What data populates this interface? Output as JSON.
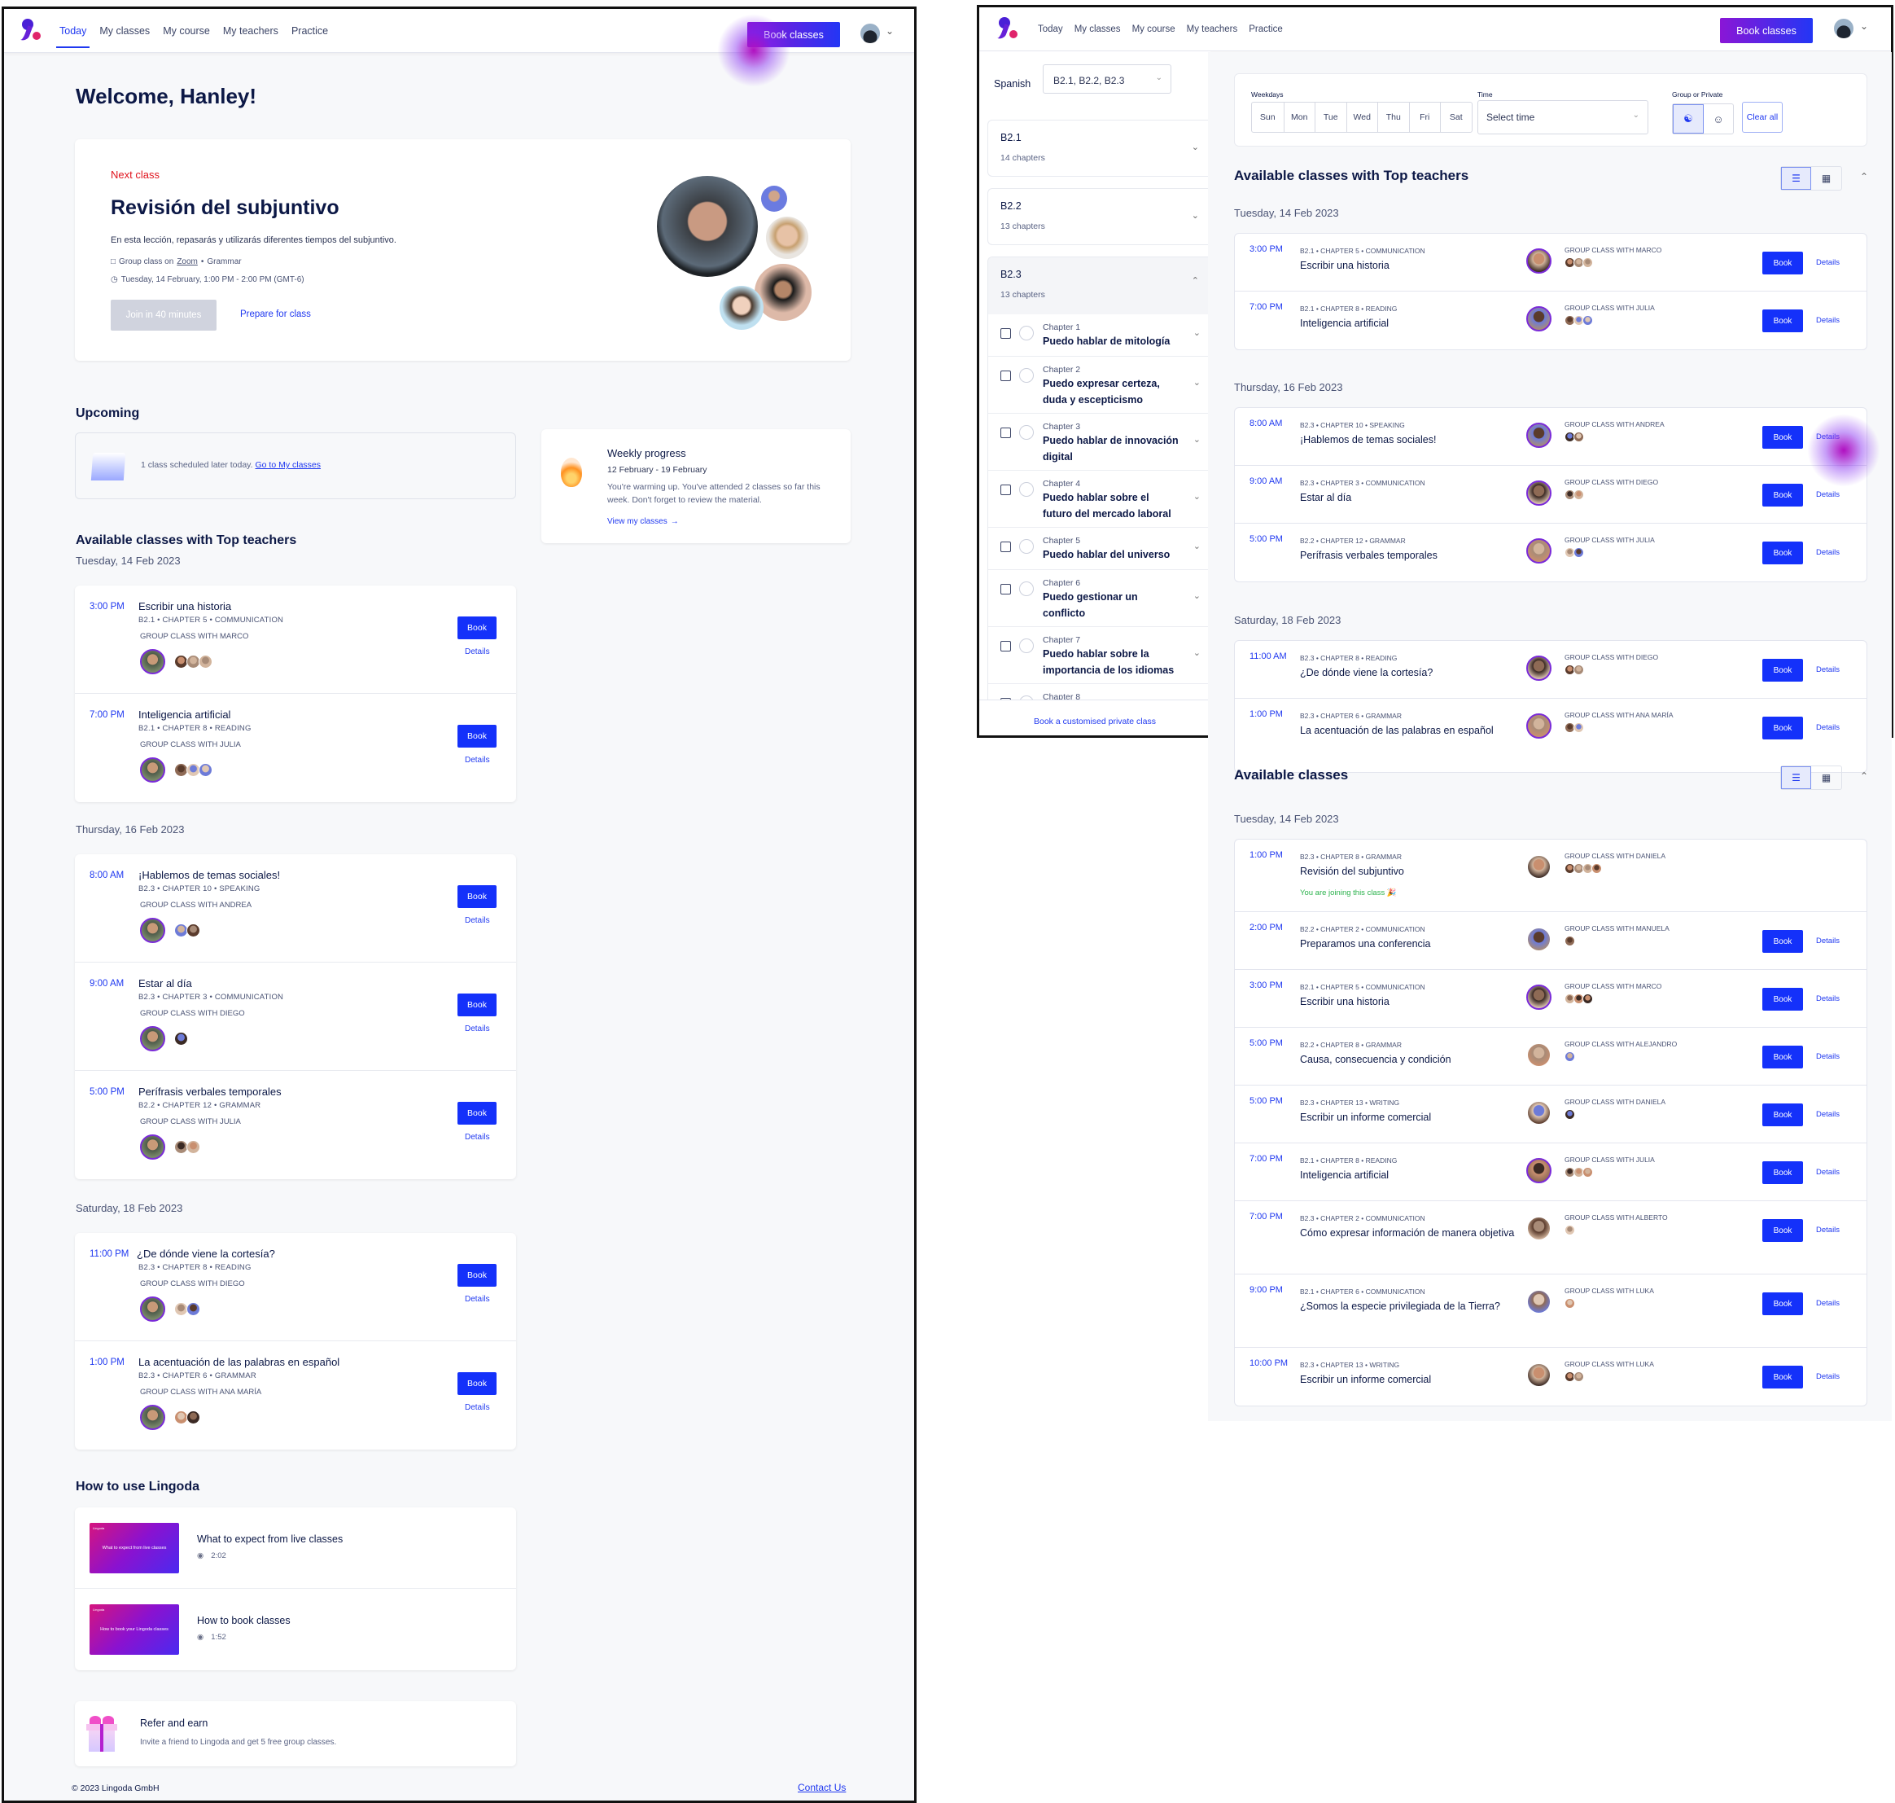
{
  "nav": {
    "links": [
      "Today",
      "My classes",
      "My course",
      "My teachers",
      "Practice"
    ],
    "active": "Today",
    "book_classes": "Book classes"
  },
  "today": {
    "welcome": "Welcome, Hanley!",
    "next_class": {
      "label": "Next class",
      "title": "Revisión del subjuntivo",
      "description": "En esta lección, repasarás y utilizarás diferentes tiempos del subjuntivo.",
      "format": "Group class on",
      "platform": "Zoom",
      "topic": "Grammar",
      "datetime": "Tuesday, 14 February, 1:00 PM - 2:00 PM (GMT-6)",
      "join_button": "Join in 40 minutes",
      "prepare_link": "Prepare for class"
    },
    "upcoming": {
      "heading": "Upcoming",
      "text": "1 class scheduled later today.",
      "link": "Go to My classes"
    },
    "weekly_progress": {
      "title": "Weekly progress",
      "range": "12 February - 19 February",
      "text": "You're warming up. You've attended 2 classes so far this week. Don't forget to review the material.",
      "link": "View my classes"
    },
    "top_heading": "Available classes with Top teachers",
    "groups": [
      {
        "date": "Tuesday, 14 Feb 2023",
        "classes": [
          {
            "time": "3:00 PM",
            "title": "Escribir una historia",
            "meta": "B2.1 • CHAPTER 5 • COMMUNICATION",
            "teacher": "GROUP CLASS WITH MARCO",
            "students": 3
          },
          {
            "time": "7:00 PM",
            "title": "Inteligencia artificial",
            "meta": "B2.1 • CHAPTER 8 • READING",
            "teacher": "GROUP CLASS WITH JULIA",
            "students": 3
          }
        ]
      },
      {
        "date": "Thursday, 16 Feb 2023",
        "classes": [
          {
            "time": "8:00 AM",
            "title": "¡Hablemos de temas sociales!",
            "meta": "B2.3 • CHAPTER 10 • SPEAKING",
            "teacher": "GROUP CLASS WITH ANDREA",
            "students": 2
          },
          {
            "time": "9:00 AM",
            "title": "Estar al día",
            "meta": "B2.3 • CHAPTER 3 • COMMUNICATION",
            "teacher": "GROUP CLASS WITH DIEGO",
            "students": 1
          },
          {
            "time": "5:00 PM",
            "title": "Perífrasis verbales temporales",
            "meta": "B2.2 • CHAPTER 12 • GRAMMAR",
            "teacher": "GROUP CLASS WITH JULIA",
            "students": 2
          }
        ]
      },
      {
        "date": "Saturday, 18 Feb 2023",
        "classes": [
          {
            "time": "11:00 PM",
            "title": "¿De dónde viene la cortesía?",
            "meta": "B2.3 • CHAPTER 8 • READING",
            "teacher": "GROUP CLASS WITH DIEGO",
            "students": 2
          },
          {
            "time": "1:00 PM",
            "title": "La acentuación de las palabras en español",
            "meta": "B2.3 • CHAPTER 6 • GRAMMAR",
            "teacher": "GROUP CLASS WITH ANA MARÍA",
            "students": 2
          }
        ]
      }
    ],
    "book_label": "Book",
    "details_label": "Details",
    "howto": {
      "heading": "How to use Lingoda",
      "videos": [
        {
          "title": "What to expect from live classes",
          "thumb": "What to expect from live classes",
          "duration": "2:02"
        },
        {
          "title": "How to book classes",
          "thumb": "How to book your Lingoda classes",
          "duration": "1:52"
        }
      ],
      "thumb_brand": "Lingoda"
    },
    "refer": {
      "title": "Refer and earn",
      "text": "Invite a friend to Lingoda and get 5 free group classes."
    },
    "footer": {
      "copyright": "© 2023 Lingoda GmbH",
      "contact": "Contact Us"
    }
  },
  "booking": {
    "language": "Spanish",
    "levels_select": "B2.1, B2.2, B2.3",
    "levels": [
      {
        "name": "B2.1",
        "chapters": "14 chapters",
        "expanded": false
      },
      {
        "name": "B2.2",
        "chapters": "13 chapters",
        "expanded": false
      },
      {
        "name": "B2.3",
        "chapters": "13 chapters",
        "expanded": true
      }
    ],
    "chapters": [
      {
        "num": "Chapter 1",
        "title": "Puedo hablar de mitología"
      },
      {
        "num": "Chapter 2",
        "title": "Puedo expresar certeza, duda y escepticismo"
      },
      {
        "num": "Chapter 3",
        "title": "Puedo hablar de innovación digital"
      },
      {
        "num": "Chapter 4",
        "title": "Puedo hablar sobre el futuro del mercado laboral"
      },
      {
        "num": "Chapter 5",
        "title": "Puedo hablar del universo"
      },
      {
        "num": "Chapter 6",
        "title": "Puedo gestionar un conflicto"
      },
      {
        "num": "Chapter 7",
        "title": "Puedo hablar sobre la importancia de los idiomas"
      },
      {
        "num": "Chapter 8",
        "title": ""
      }
    ],
    "private_link": "Book a customised private class",
    "filters": {
      "weekdays_label": "Weekdays",
      "weekdays": [
        "Sun",
        "Mon",
        "Tue",
        "Wed",
        "Thu",
        "Fri",
        "Sat"
      ],
      "time_label": "Time",
      "time_placeholder": "Select time",
      "type_label": "Group or Private",
      "type_selected": "group",
      "clear": "Clear all"
    },
    "top_heading": "Available classes with Top teachers",
    "top_groups": [
      {
        "date": "Tuesday, 14 Feb 2023",
        "classes": [
          {
            "time": "3:00 PM",
            "meta": "B2.1 • CHAPTER 5 • COMMUNICATION",
            "title": "Escribir una historia",
            "teacher": "GROUP CLASS WITH MARCO",
            "students": 3
          },
          {
            "time": "7:00 PM",
            "meta": "B2.1 • CHAPTER 8 • READING",
            "title": "Inteligencia artificial",
            "teacher": "GROUP CLASS WITH JULIA",
            "students": 3
          }
        ]
      },
      {
        "date": "Thursday, 16 Feb 2023",
        "classes": [
          {
            "time": "8:00 AM",
            "meta": "B2.3 • CHAPTER 10 • SPEAKING",
            "title": "¡Hablemos de temas sociales!",
            "teacher": "GROUP CLASS WITH ANDREA",
            "students": 2
          },
          {
            "time": "9:00 AM",
            "meta": "B2.3 • CHAPTER 3 • COMMUNICATION",
            "title": "Estar al día",
            "teacher": "GROUP CLASS WITH DIEGO",
            "students": 2
          },
          {
            "time": "5:00 PM",
            "meta": "B2.2 • CHAPTER 12 • GRAMMAR",
            "title": "Perífrasis verbales temporales",
            "teacher": "GROUP CLASS WITH JULIA",
            "students": 2
          }
        ]
      },
      {
        "date": "Saturday, 18 Feb 2023",
        "classes": [
          {
            "time": "11:00 AM",
            "meta": "B2.3 • CHAPTER 8 • READING",
            "title": "¿De dónde viene la cortesía?",
            "teacher": "GROUP CLASS WITH DIEGO",
            "students": 2
          },
          {
            "time": "1:00 PM",
            "meta": "B2.3 • CHAPTER 6 • GRAMMAR",
            "title": "La acentuación de las palabras en español",
            "teacher": "GROUP CLASS WITH ANA MARÍA",
            "students": 2
          }
        ]
      }
    ],
    "all_heading": "Available classes",
    "all_groups": [
      {
        "date": "Tuesday, 14 Feb 2023",
        "classes": [
          {
            "time": "1:00 PM",
            "meta": "B2.3 • CHAPTER 8 • GRAMMAR",
            "title": "Revisión del subjuntivo",
            "teacher": "GROUP CLASS WITH DANIELA",
            "students": 4,
            "joining": "You are joining this class 🎉"
          },
          {
            "time": "2:00 PM",
            "meta": "B2.2 • CHAPTER 2 • COMMUNICATION",
            "title": "Preparamos una conferencia",
            "teacher": "GROUP CLASS WITH MANUELA",
            "students": 1
          },
          {
            "time": "3:00 PM",
            "meta": "B2.1 • CHAPTER 5 • COMMUNICATION",
            "title": "Escribir una historia",
            "teacher": "GROUP CLASS WITH MARCO",
            "students": 3,
            "top": true
          },
          {
            "time": "5:00 PM",
            "meta": "B2.2 • CHAPTER 8 • GRAMMAR",
            "title": "Causa, consecuencia y condición",
            "teacher": "GROUP CLASS WITH ALEJANDRO",
            "students": 1
          },
          {
            "time": "5:00 PM",
            "meta": "B2.3 • CHAPTER 13 • WRITING",
            "title": "Escribir un informe comercial",
            "teacher": "GROUP CLASS WITH DANIELA",
            "students": 1
          },
          {
            "time": "7:00 PM",
            "meta": "B2.1 • CHAPTER 8 • READING",
            "title": "Inteligencia artificial",
            "teacher": "GROUP CLASS WITH JULIA",
            "students": 3,
            "top": true
          },
          {
            "time": "7:00 PM",
            "meta": "B2.3 • CHAPTER 2 • COMMUNICATION",
            "title": "Cómo expresar información de manera objetiva",
            "teacher": "GROUP CLASS WITH ALBERTO",
            "students": 1
          },
          {
            "time": "9:00 PM",
            "meta": "B2.1 • CHAPTER 6 • COMMUNICATION",
            "title": "¿Somos la especie privilegiada de la Tierra?",
            "teacher": "GROUP CLASS WITH LUKA",
            "students": 1
          },
          {
            "time": "10:00 PM",
            "meta": "B2.3 • CHAPTER 13 • WRITING",
            "title": "Escribir un informe comercial",
            "teacher": "GROUP CLASS WITH LUKA",
            "students": 2
          }
        ]
      }
    ],
    "book_label": "Book",
    "details_label": "Details"
  },
  "colors": {
    "accent": "#1431fa",
    "link": "#1f38f0",
    "next_label": "#e0141e",
    "joining": "#2bb24c",
    "text": "#0c1846"
  }
}
